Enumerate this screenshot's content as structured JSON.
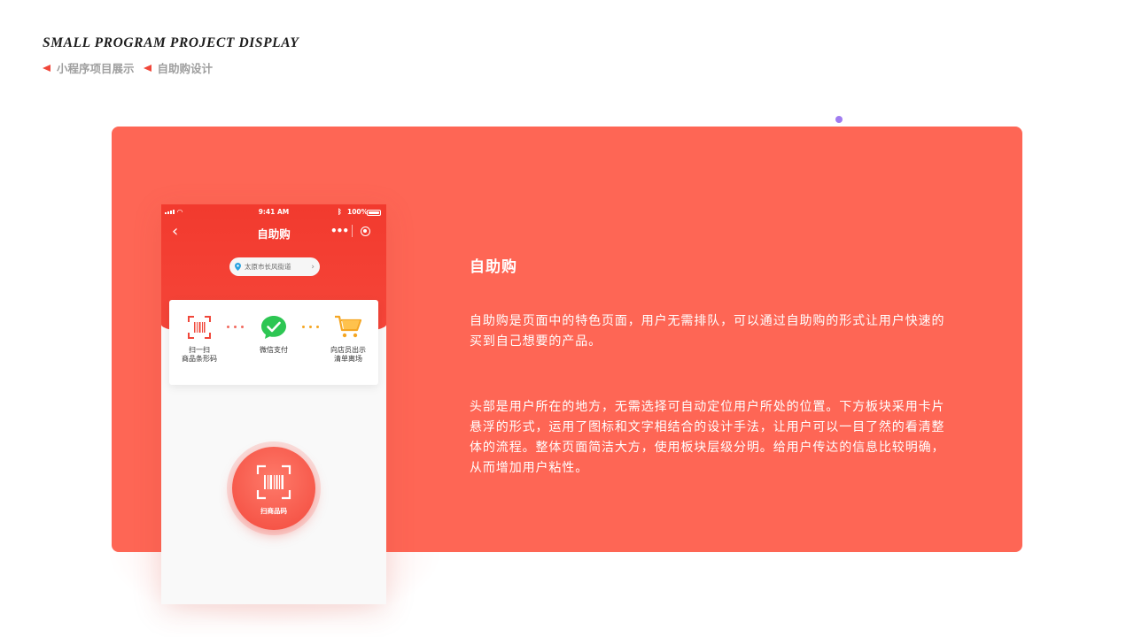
{
  "header": {
    "title_en": "SMALL PROGRAM PROJECT DISPLAY",
    "crumb1": "小程序项目展示",
    "crumb2": "自助购设计"
  },
  "phone": {
    "status_time": "9:41 AM",
    "status_battery": "100%",
    "nav_title": "自助购",
    "nav_more": "•••",
    "location": "太原市长风街道",
    "steps": [
      {
        "icon": "scan-barcode-icon",
        "label_line1": "扫一扫",
        "label_line2": "商品条形码"
      },
      {
        "icon": "wechat-pay-check-icon",
        "label_line1": "微信支付",
        "label_line2": ""
      },
      {
        "icon": "shopping-cart-icon",
        "label_line1": "向店员出示",
        "label_line2": "清单离场"
      }
    ],
    "scan_button_label": "扫商品码"
  },
  "content": {
    "title": "自助购",
    "paragraph1": "自助购是页面中的特色页面，用户无需排队，可以通过自助购的形式让用户快速的买到自己想要的产品。",
    "paragraph2": "头部是用户所在的地方，无需选择可自动定位用户所处的位置。下方板块采用卡片悬浮的形式，运用了图标和文字相结合的设计手法，让用户可以一目了然的看清整体的流程。整体页面简洁大方，使用板块层级分明。给用户传达的信息比较明确，从而增加用户粘性。"
  },
  "colors": {
    "panel": "#fe6655",
    "phone_header": "#f23a2e",
    "accent_red": "#f0473a",
    "wechat_green": "#2dc653",
    "cart_orange": "#f5a623",
    "dot_purple": "#a07cf0"
  }
}
